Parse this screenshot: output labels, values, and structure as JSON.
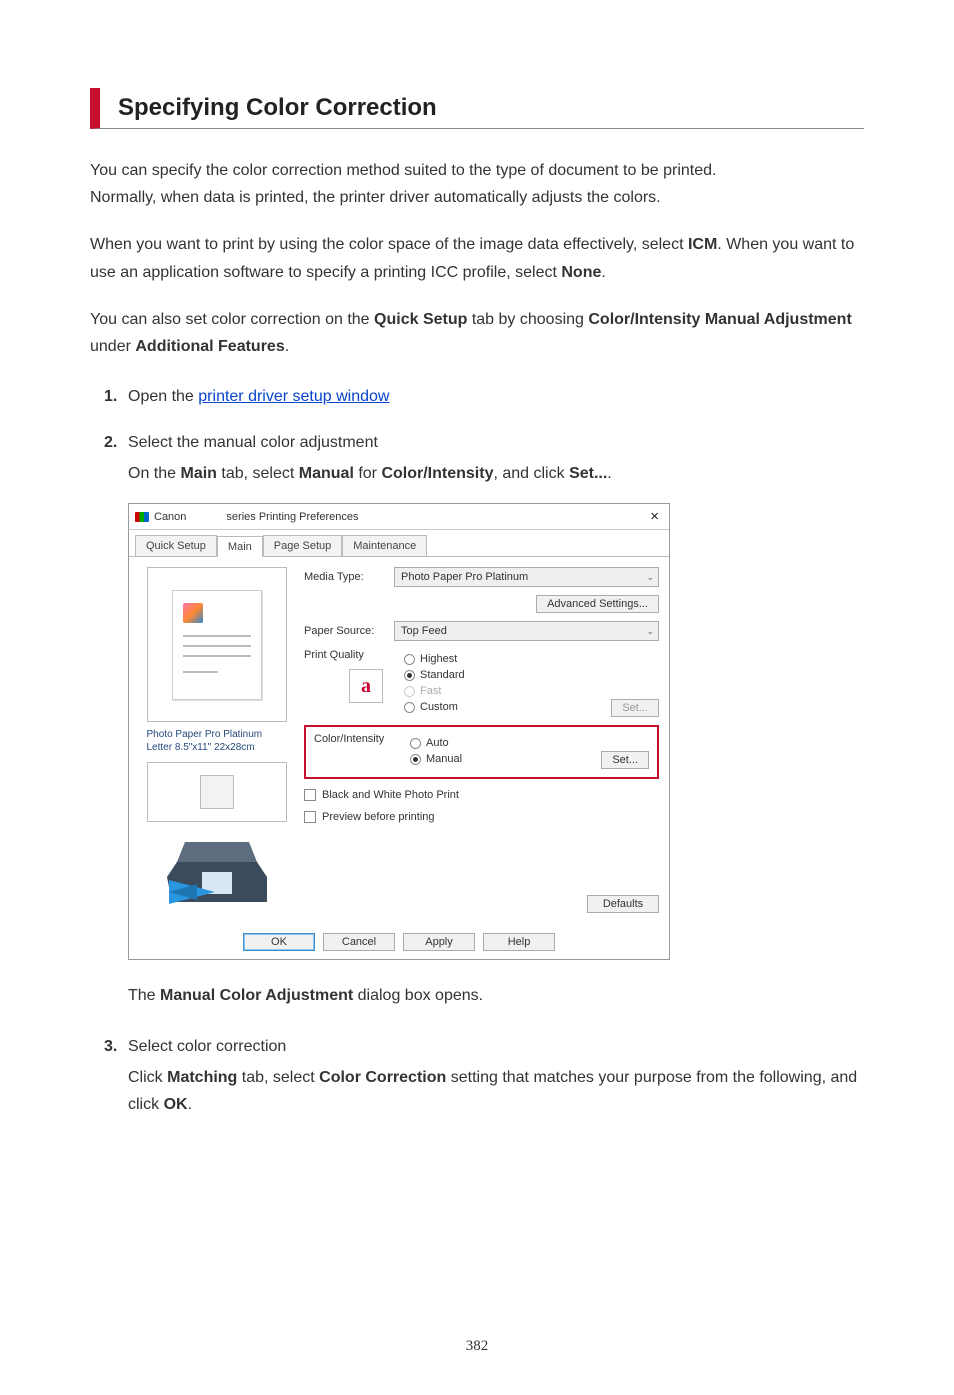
{
  "page": {
    "title": "Specifying Color Correction",
    "para1": "You can specify the color correction method suited to the type of document to be printed.",
    "para2": "Normally, when data is printed, the printer driver automatically adjusts the colors.",
    "para3_a": "When you want to print by using the color space of the image data effectively, select ",
    "para3_icm": "ICM",
    "para3_b": ". When you want to use an application software to specify a printing ICC profile, select ",
    "para3_none": "None",
    "para3_c": ".",
    "para4_a": "You can also set color correction on the ",
    "para4_qs": "Quick Setup",
    "para4_b": " tab by choosing ",
    "para4_cima": "Color/Intensity Manual Adjustment",
    "para4_c": " under ",
    "para4_af": "Additional Features",
    "para4_d": ".",
    "page_number": "382"
  },
  "steps": {
    "s1_num": "1.",
    "s1_title_a": "Open the ",
    "s1_link": "printer driver setup window",
    "s2_num": "2.",
    "s2_title": "Select the manual color adjustment",
    "s2_body_a": "On the ",
    "s2_main": "Main",
    "s2_body_b": " tab, select ",
    "s2_manual": "Manual",
    "s2_body_c": " for ",
    "s2_ci": "Color/Intensity",
    "s2_body_d": ", and click ",
    "s2_set": "Set...",
    "s2_body_e": ".",
    "s2_note_a": "The ",
    "s2_note_mca": "Manual Color Adjustment",
    "s2_note_b": " dialog box opens.",
    "s3_num": "3.",
    "s3_title": "Select color correction",
    "s3_body_a": "Click ",
    "s3_match": "Matching",
    "s3_body_b": " tab, select ",
    "s3_cc": "Color Correction",
    "s3_body_c": " setting that matches your purpose from the following, and click ",
    "s3_ok": "OK",
    "s3_body_d": "."
  },
  "dialog": {
    "title_pre": "Canon",
    "title_post": "series Printing Preferences",
    "tabs": [
      "Quick Setup",
      "Main",
      "Page Setup",
      "Maintenance"
    ],
    "labels": {
      "media_type": "Media Type:",
      "paper_source": "Paper Source:",
      "print_quality": "Print Quality",
      "color_intensity": "Color/Intensity"
    },
    "values": {
      "media_type": "Photo Paper Pro Platinum",
      "paper_source": "Top Feed"
    },
    "btn_adv": "Advanced Settings...",
    "quality": {
      "highest": "Highest",
      "standard": "Standard",
      "fast": "Fast",
      "custom": "Custom"
    },
    "btn_qset": "Set...",
    "ci": {
      "auto": "Auto",
      "manual": "Manual"
    },
    "btn_ci_set": "Set...",
    "chk_bw": "Black and White Photo Print",
    "chk_preview": "Preview before printing",
    "btn_defaults": "Defaults",
    "btn_ok": "OK",
    "btn_cancel": "Cancel",
    "btn_apply": "Apply",
    "btn_help": "Help",
    "preview_caption1": "Photo Paper Pro Platinum",
    "preview_caption2": "Letter 8.5\"x11\" 22x28cm",
    "glyph_a": "a"
  }
}
